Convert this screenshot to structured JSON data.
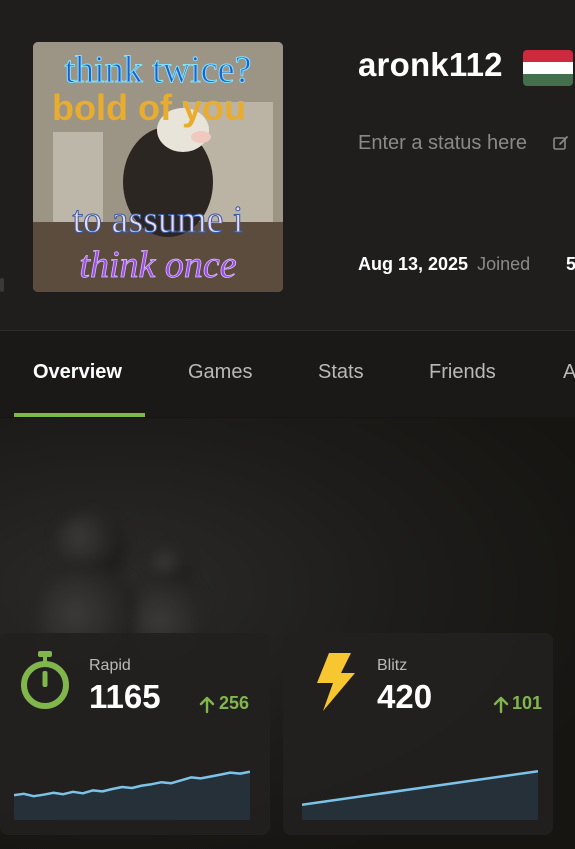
{
  "profile": {
    "avatar_meme": {
      "line1": "think twice?",
      "line2": "bold of you",
      "line3": "to assume i",
      "line4": "think once"
    },
    "username": "aronk112",
    "country_flag": "hungary-flag",
    "flag_colors": [
      "#cd2a3e",
      "#ffffff",
      "#436f4d"
    ],
    "status_placeholder": "Enter a status here",
    "joined_date": "Aug 13, 2025",
    "joined_label": "Joined",
    "next_stat_partial": "5"
  },
  "tabs": [
    {
      "label": "Overview",
      "active": true
    },
    {
      "label": "Games",
      "active": false
    },
    {
      "label": "Stats",
      "active": false
    },
    {
      "label": "Friends",
      "active": false
    },
    {
      "label": "A",
      "active": false
    }
  ],
  "ratings": [
    {
      "mode": "Rapid",
      "rating": "1165",
      "change": "256",
      "icon": "stopwatch-icon",
      "icon_color": "#81b64c",
      "trend": [
        0.35,
        0.38,
        0.33,
        0.36,
        0.4,
        0.37,
        0.42,
        0.39,
        0.45,
        0.43,
        0.48,
        0.52,
        0.5,
        0.55,
        0.58,
        0.62,
        0.6,
        0.66,
        0.72,
        0.7,
        0.74,
        0.78,
        0.82,
        0.8,
        0.84
      ]
    },
    {
      "mode": "Blitz",
      "rating": "420",
      "change": "101",
      "icon": "lightning-icon",
      "icon_color": "#f7c631",
      "trend": [
        0.15,
        0.85
      ]
    }
  ],
  "colors": {
    "accent_green": "#81b64c",
    "sparkline": "#7dc3e8",
    "background": "#161512"
  }
}
